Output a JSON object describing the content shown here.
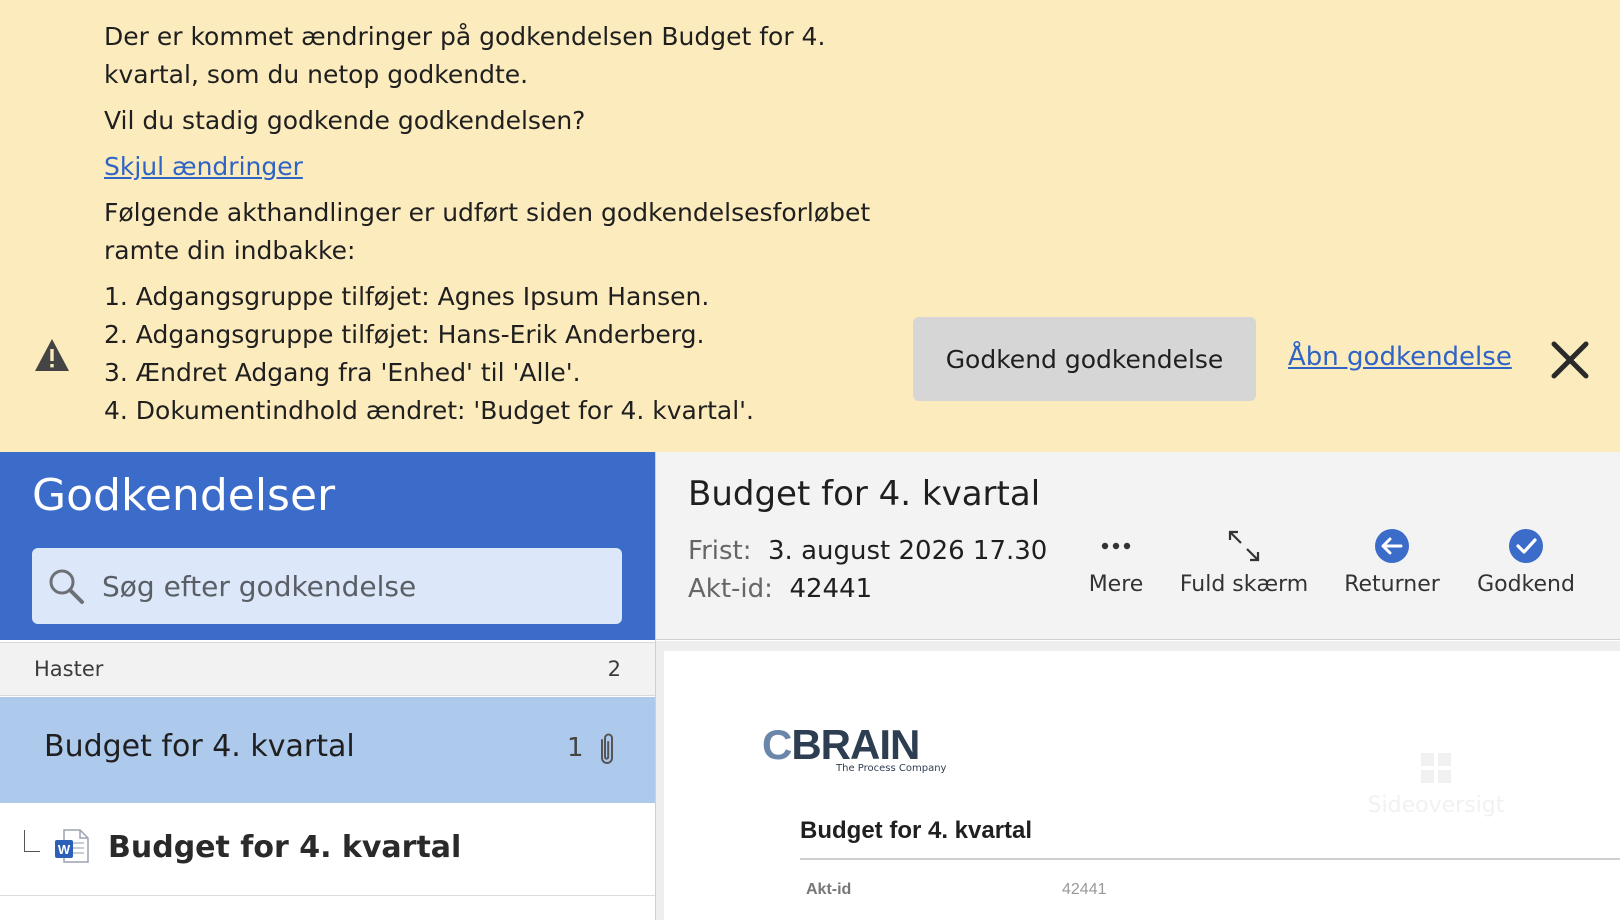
{
  "banner": {
    "message_line": "Der er kommet ændringer på godkendelsen Budget for 4. kvartal, som du netop godkendte.",
    "question": "Vil du stadig godkende godkendelsen?",
    "toggle_link": "Skjul ændringer",
    "changes_intro": "Følgende akthandlinger er udført siden godkendelsesforløbet ramte din indbakke:",
    "changes": [
      "1. Adgangsgruppe tilføjet: Agnes Ipsum Hansen.",
      "2. Adgangsgruppe tilføjet: Hans-Erik Anderberg.",
      "3. Ændret Adgang fra 'Enhed' til 'Alle'.",
      "4. Dokumentindhold ændret: 'Budget for 4. kvartal'."
    ],
    "approve_button": "Godkend godkendelse",
    "open_link": "Åbn godkendelse",
    "icons": {
      "warning": "warning-icon",
      "close": "close-icon"
    }
  },
  "sidebar": {
    "title": "Godkendelser",
    "search_placeholder": "Søg efter godkendelse",
    "section": {
      "label": "Haster",
      "count": "2"
    },
    "selected_item": {
      "title": "Budget for 4. kvartal",
      "count": "1"
    },
    "child_item": {
      "title": "Budget for 4. kvartal"
    }
  },
  "detail": {
    "title": "Budget for 4. kvartal",
    "deadline_label": "Frist:",
    "deadline_value": "3. august 2026 17.30",
    "id_label": "Akt-id:",
    "id_value": "42441",
    "toolbar": {
      "more": "Mere",
      "fullscreen": "Fuld skærm",
      "return": "Returner",
      "approve": "Godkend"
    }
  },
  "document": {
    "logo_main": "CBRAIN",
    "logo_sub": "The Process Company",
    "heading": "Budget for 4. kvartal",
    "field_label": "Akt-id",
    "field_value": "42441",
    "page_overview": "Sideoversigt"
  },
  "colors": {
    "banner_bg": "#fcebbd",
    "sidebar_header": "#3b6cc9",
    "selected_row": "#adc9ec",
    "link": "#2f63c6",
    "toolbar_blue": "#3b6cc9"
  }
}
